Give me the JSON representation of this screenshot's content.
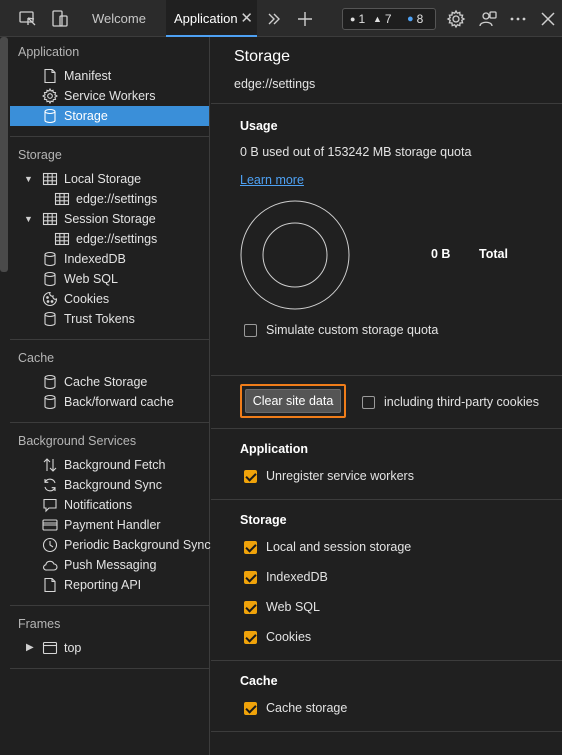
{
  "toolbar": {
    "tabs": [
      {
        "label": "Welcome"
      },
      {
        "label": "Application",
        "close": "✕"
      }
    ],
    "icons": [
      "inspect-icon",
      "device-emulation-icon",
      "more-tabs-icon",
      "add-tab-icon",
      "settings-icon",
      "customize-icon",
      "more-options-icon",
      "close-devtools-icon"
    ],
    "badges": {
      "errors": "1",
      "warnings": "7",
      "issues": "8"
    }
  },
  "sidebar": {
    "application": {
      "title": "Application",
      "items": [
        {
          "label": "Manifest",
          "icon": "document-icon"
        },
        {
          "label": "Service Workers",
          "icon": "gear-icon"
        },
        {
          "label": "Storage",
          "icon": "database-icon",
          "selected": true
        }
      ]
    },
    "storage": {
      "title": "Storage",
      "items": [
        {
          "label": "Local Storage",
          "icon": "grid-icon"
        },
        {
          "label": "edge://settings",
          "icon": "grid-icon"
        },
        {
          "label": "Session Storage",
          "icon": "grid-icon"
        },
        {
          "label": "edge://settings",
          "icon": "grid-icon"
        },
        {
          "label": "IndexedDB",
          "icon": "database-icon"
        },
        {
          "label": "Web SQL",
          "icon": "database-icon"
        },
        {
          "label": "Cookies",
          "icon": "cookie-icon"
        },
        {
          "label": "Trust Tokens",
          "icon": "database-icon"
        }
      ]
    },
    "cache": {
      "title": "Cache",
      "items": [
        {
          "label": "Cache Storage",
          "icon": "database-icon"
        },
        {
          "label": "Back/forward cache",
          "icon": "database-icon"
        }
      ]
    },
    "background": {
      "title": "Background Services",
      "items": [
        {
          "label": "Background Fetch",
          "icon": "arrows-updown-icon"
        },
        {
          "label": "Background Sync",
          "icon": "sync-icon"
        },
        {
          "label": "Notifications",
          "icon": "comment-icon"
        },
        {
          "label": "Payment Handler",
          "icon": "credit-card-icon"
        },
        {
          "label": "Periodic Background Sync",
          "icon": "clock-icon"
        },
        {
          "label": "Push Messaging",
          "icon": "cloud-icon"
        },
        {
          "label": "Reporting API",
          "icon": "document-icon"
        }
      ]
    },
    "frames": {
      "title": "Frames",
      "items": [
        {
          "label": "top",
          "icon": "frame-icon"
        }
      ]
    }
  },
  "main": {
    "title": "Storage",
    "origin": "edge://settings",
    "usage": {
      "heading": "Usage",
      "summary": "0 B used out of 153242 MB storage quota",
      "learn_more": "Learn more",
      "total_value": "0 B",
      "total_label": "Total",
      "simulate_label": "Simulate custom storage quota",
      "simulate_checked": false
    },
    "clear": {
      "button_label": "Clear site data",
      "third_party_label": "including third-party cookies",
      "third_party_checked": false,
      "highlight_color": "#f07d1a"
    },
    "application_section": {
      "heading": "Application",
      "options": [
        {
          "label": "Unregister service workers",
          "checked": true
        }
      ]
    },
    "storage_section": {
      "heading": "Storage",
      "options": [
        {
          "label": "Local and session storage",
          "checked": true
        },
        {
          "label": "IndexedDB",
          "checked": true
        },
        {
          "label": "Web SQL",
          "checked": true
        },
        {
          "label": "Cookies",
          "checked": true
        }
      ]
    },
    "cache_section": {
      "heading": "Cache",
      "options": [
        {
          "label": "Cache storage",
          "checked": true
        }
      ]
    }
  },
  "colors": {
    "accent": "#3a8fd9",
    "link": "#4ea1f3",
    "checkbox": "#f0a30a",
    "background": "#202020"
  }
}
